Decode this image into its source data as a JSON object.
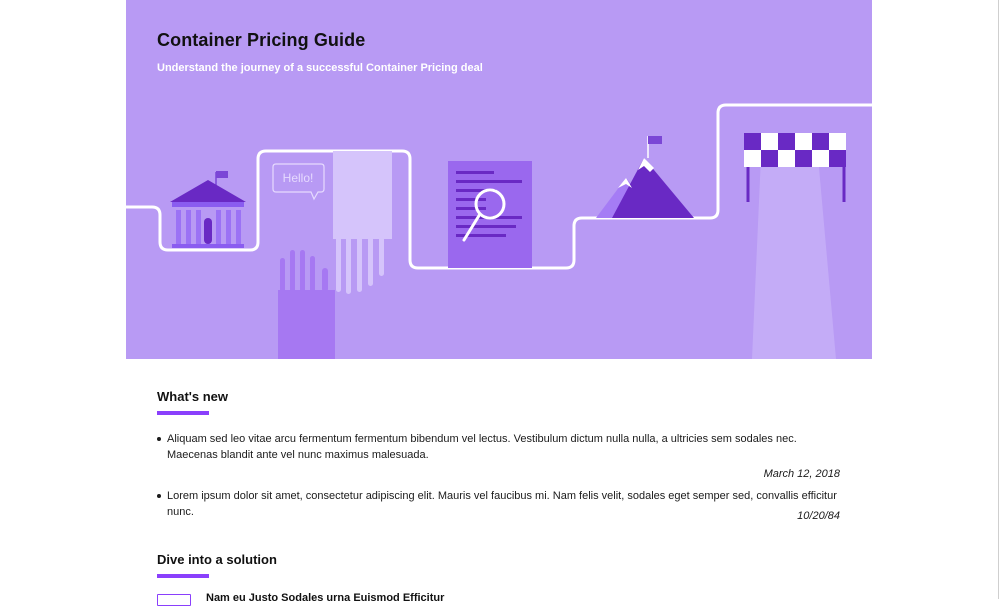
{
  "hero": {
    "title": "Container Pricing Guide",
    "subtitle": "Understand the journey of a successful Container Pricing deal",
    "speech_bubble": "Hello!",
    "background_color": "#b89af4",
    "accent_color": "#8a3ffc"
  },
  "whats_new": {
    "heading": "What's new",
    "items": [
      {
        "text": "Aliquam sed leo vitae arcu fermentum fermentum bibendum vel lectus. Vestibulum dictum nulla nulla, a ultricies sem sodales nec. Maecenas blandit ante vel nunc maximus malesuada.",
        "date": "March 12, 2018"
      },
      {
        "text": "Lorem ipsum dolor sit amet, consectetur adipiscing elit. Mauris vel faucibus mi. Nam felis velit, sodales eget semper sed, convallis efficitur nunc.",
        "date": "10/20/84"
      }
    ]
  },
  "solutions": {
    "heading": "Dive into a solution",
    "items": [
      {
        "label": "Nam eu Justo Sodales urna Euismod Efficitur",
        "icon": "window-icon"
      }
    ]
  }
}
